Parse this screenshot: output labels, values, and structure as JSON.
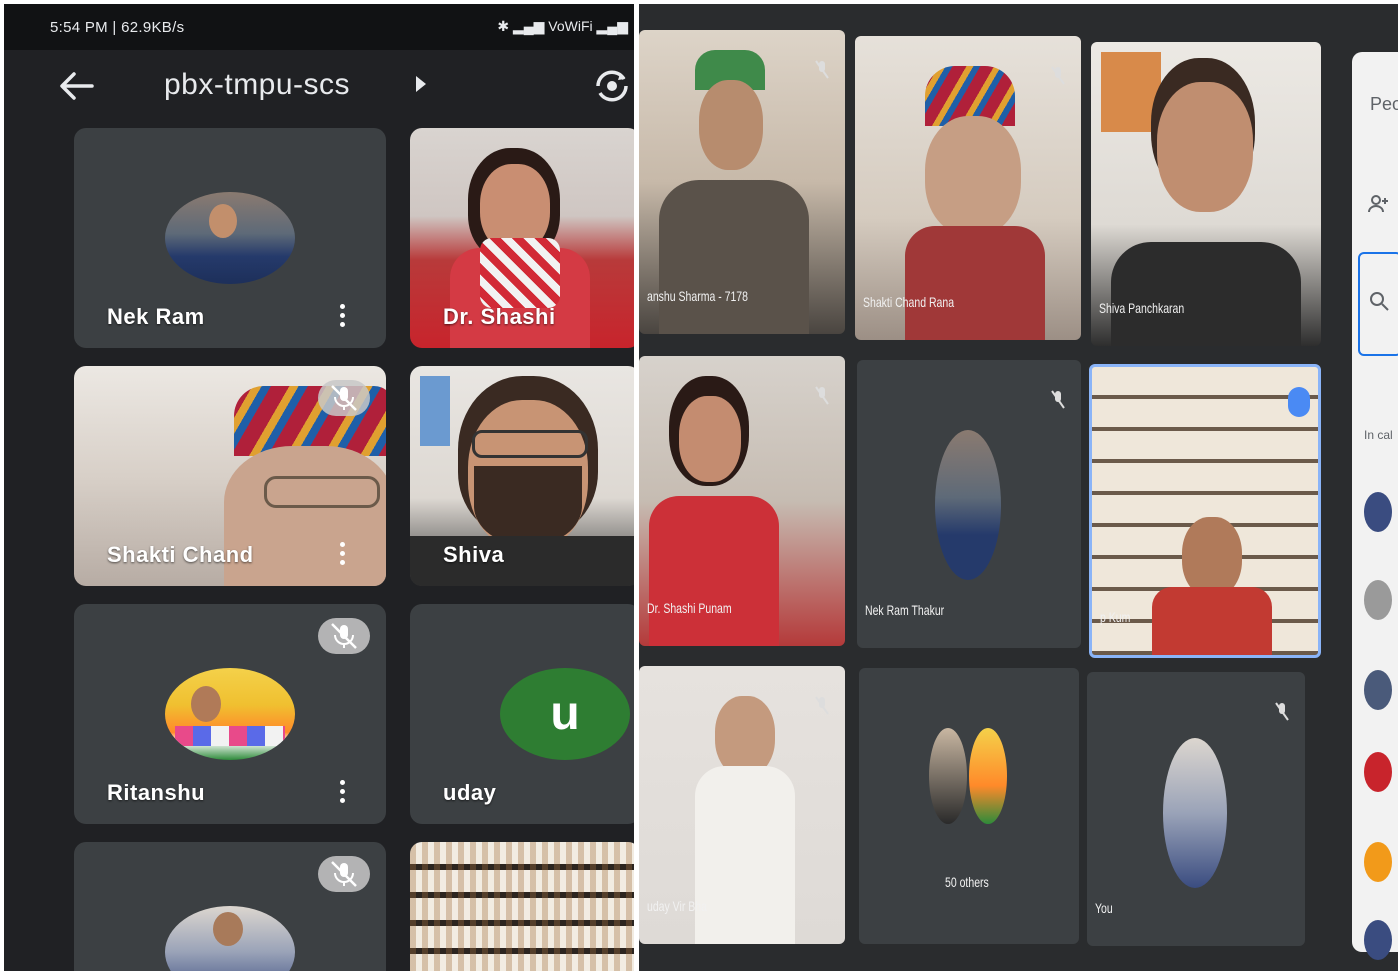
{
  "phone": {
    "status_time": "5:54 PM | 62.9KB/s",
    "status_right": "✱ ▂▄▆ VoWiFi ▂▄▆",
    "meeting_code": "pbx-tmpu-scs",
    "tiles": [
      {
        "name": "Nek Ram"
      },
      {
        "name": "Dr. Shashi"
      },
      {
        "name": "Shakti Chand"
      },
      {
        "name": "Shiva"
      },
      {
        "name": "Ritanshu"
      },
      {
        "name": "uday",
        "letter": "u"
      }
    ]
  },
  "monitor": {
    "tiles": [
      {
        "name": "anshu Sharma - 7178"
      },
      {
        "name": "Shakti Chand Rana"
      },
      {
        "name": "Shiva Panchkaran"
      },
      {
        "name": "Dr. Shashi Punam"
      },
      {
        "name": "Nek Ram Thakur"
      },
      {
        "name": "p Kum"
      },
      {
        "name": "uday Vir Bha"
      },
      {
        "name": "50 others"
      },
      {
        "name": "You"
      }
    ],
    "panel_title": "Peo",
    "panel_incall": "In cal"
  },
  "colors": {
    "phone_bg": "#202124",
    "tile_bg": "#3c4043",
    "uday_avatar": "#2e7d32"
  }
}
